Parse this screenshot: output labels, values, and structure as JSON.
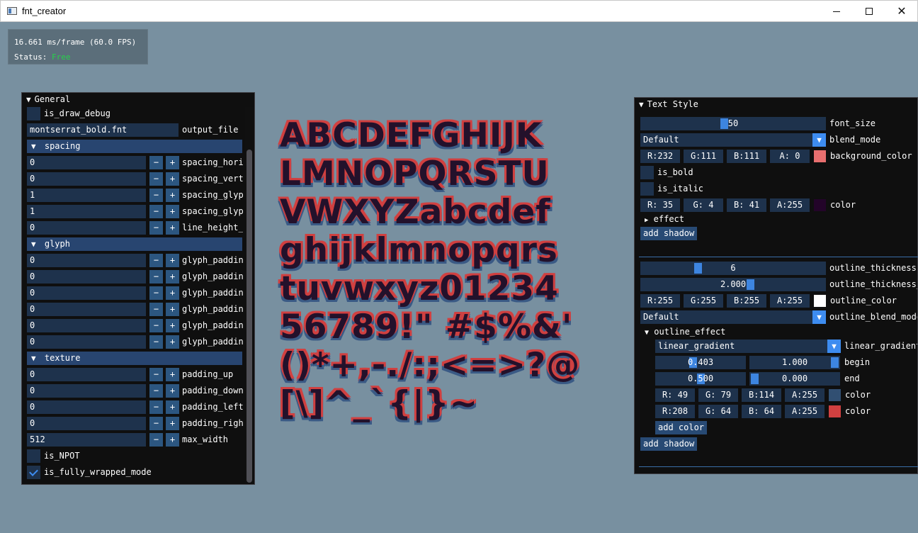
{
  "window": {
    "title": "fnt_creator"
  },
  "overlay": {
    "frame_info": "16.661 ms/frame (60.0 FPS)",
    "status_label": "Status:",
    "status_value": "Free"
  },
  "general": {
    "header": "General",
    "is_draw_debug": {
      "label": "is_draw_debug",
      "checked": false
    },
    "output_file": {
      "value": "montserrat_bold.fnt",
      "label": "output_file"
    },
    "spacing": {
      "header": "spacing",
      "fields": [
        {
          "value": "0",
          "label": "spacing_hori"
        },
        {
          "value": "0",
          "label": "spacing_vert"
        },
        {
          "value": "1",
          "label": "spacing_glypl"
        },
        {
          "value": "1",
          "label": "spacing_glypl"
        },
        {
          "value": "0",
          "label": "line_height_"
        }
      ]
    },
    "glyph": {
      "header": "glyph",
      "fields": [
        {
          "value": "0",
          "label": "glyph_paddin"
        },
        {
          "value": "0",
          "label": "glyph_paddin"
        },
        {
          "value": "0",
          "label": "glyph_paddin"
        },
        {
          "value": "0",
          "label": "glyph_paddin"
        },
        {
          "value": "0",
          "label": "glyph_paddin"
        },
        {
          "value": "0",
          "label": "glyph_paddin"
        }
      ]
    },
    "texture": {
      "header": "texture",
      "fields": [
        {
          "value": "0",
          "label": "padding_up"
        },
        {
          "value": "0",
          "label": "padding_down"
        },
        {
          "value": "0",
          "label": "padding_left"
        },
        {
          "value": "0",
          "label": "padding_righ"
        },
        {
          "value": "512",
          "label": "max_width"
        }
      ],
      "is_NPOT": {
        "label": "is_NPOT",
        "checked": false
      },
      "is_fully_wrapped_mode": {
        "label": "is_fully_wrapped_mode",
        "checked": true
      }
    },
    "minus": "−",
    "plus": "+"
  },
  "preview": {
    "lines": [
      "ABCDEFGHIJK",
      "LMNOPQRSTU",
      "VWXYZabcdef",
      "ghijklmnopqrs",
      "tuvwxyz01234",
      "56789!\" #$%&'",
      "()*+,-./:;<=>?@",
      "[\\]^_`{|}~"
    ]
  },
  "text_style": {
    "header": "Text Style",
    "font_size": {
      "value": "50",
      "label": "font_size",
      "fraction": 0.45
    },
    "blend_mode": {
      "value": "Default",
      "label": "blend_mode"
    },
    "background_color": {
      "r": "R:232",
      "g": "G:111",
      "b": "B:111",
      "a": "A:  0",
      "label": "background_color",
      "swatch": "#e86f6f"
    },
    "is_bold": {
      "label": "is_bold",
      "checked": false
    },
    "is_italic": {
      "label": "is_italic",
      "checked": false
    },
    "color": {
      "r": "R: 35",
      "g": "G:  4",
      "b": "B: 41",
      "a": "A:255",
      "label": "color",
      "swatch": "#230429"
    },
    "effect": {
      "label": "effect"
    },
    "add_shadow_1": "add shadow",
    "outline_thickness": {
      "value": "6",
      "label": "outline_thickness",
      "fraction": 0.3
    },
    "outline_thickness_2": {
      "value": "2.000",
      "label": "outline_thickness_",
      "fraction": 0.6
    },
    "outline_color": {
      "r": "R:255",
      "g": "G:255",
      "b": "B:255",
      "a": "A:255",
      "label": "outline_color",
      "swatch": "#ffffff"
    },
    "outline_blend_mode": {
      "value": "Default",
      "label": "outline_blend_mode"
    },
    "outline_effect": {
      "label": "outline_effect",
      "type": {
        "value": "linear_gradient",
        "label": "linear_gradient"
      },
      "begin": {
        "v1": "0.403",
        "v2": "1.000",
        "label": "begin",
        "f1": 0.403,
        "f2": 1.0
      },
      "end": {
        "v1": "0.500",
        "v2": "0.000",
        "label": "end",
        "f1": 0.5,
        "f2": 0.0
      },
      "color1": {
        "r": "R: 49",
        "g": "G: 79",
        "b": "B:114",
        "a": "A:255",
        "label": "color",
        "swatch": "#314f72"
      },
      "color2": {
        "r": "R:208",
        "g": "G: 64",
        "b": "B: 64",
        "a": "A:255",
        "label": "color",
        "swatch": "#d04040"
      },
      "add_color": "add color"
    },
    "add_shadow_2": "add shadow"
  }
}
